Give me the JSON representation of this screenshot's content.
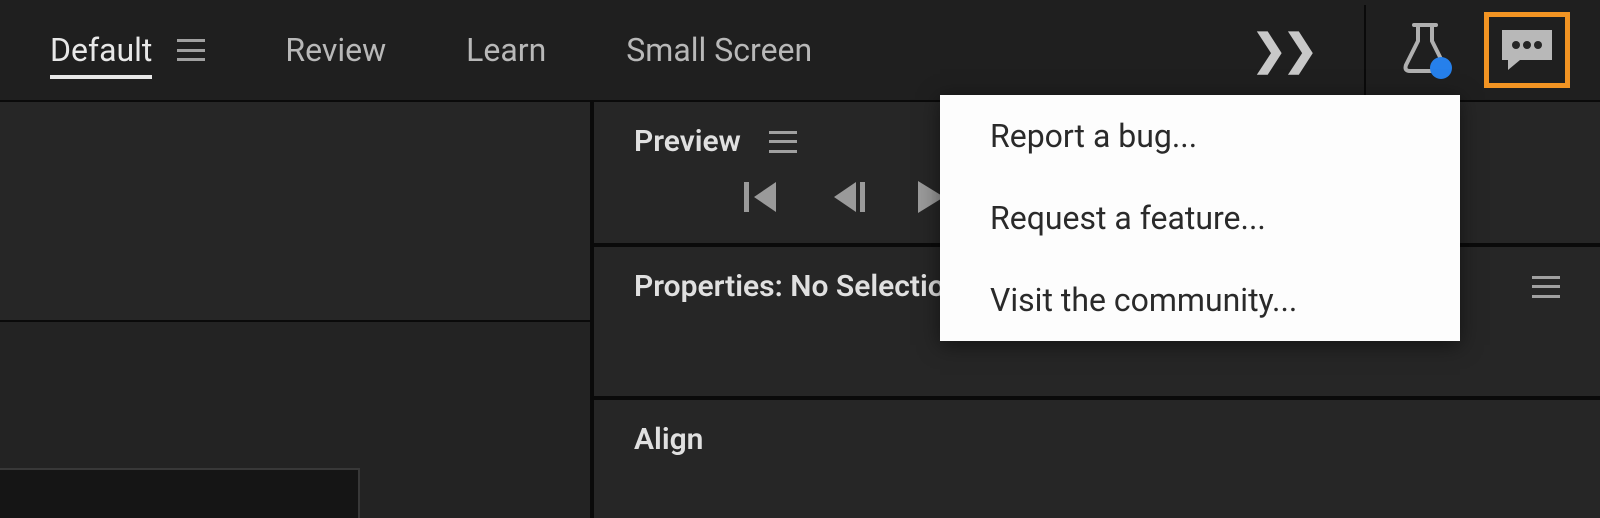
{
  "workspaces": {
    "items": [
      {
        "label": "Default",
        "active": true,
        "has_menu": true
      },
      {
        "label": "Review",
        "active": false,
        "has_menu": false
      },
      {
        "label": "Learn",
        "active": false,
        "has_menu": false
      },
      {
        "label": "Small Screen",
        "active": false,
        "has_menu": false
      }
    ]
  },
  "panels": {
    "preview": {
      "title": "Preview"
    },
    "properties": {
      "title": "Properties: No Selection"
    },
    "align": {
      "title": "Align"
    }
  },
  "feedback_menu": {
    "items": [
      {
        "label": "Report a bug..."
      },
      {
        "label": "Request a feature..."
      },
      {
        "label": "Visit the community..."
      }
    ]
  }
}
